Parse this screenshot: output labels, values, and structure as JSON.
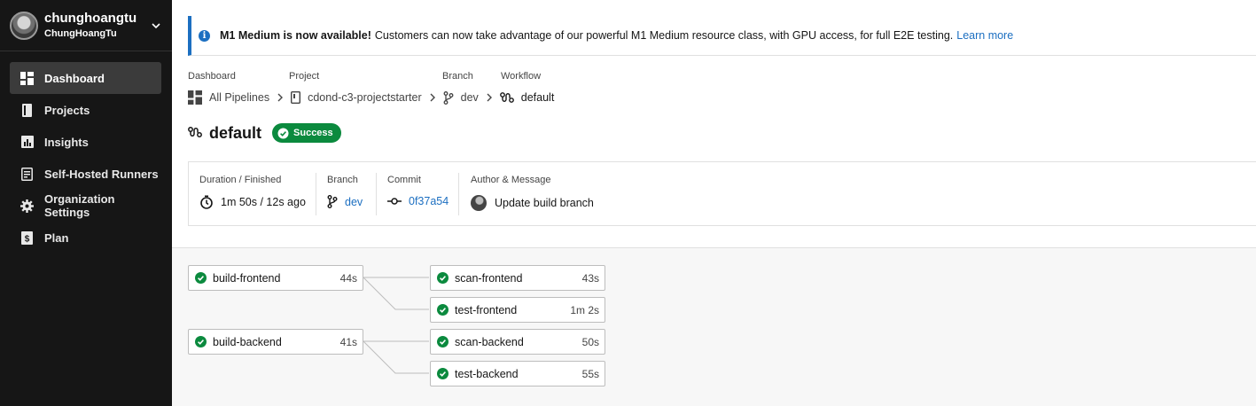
{
  "user": {
    "name": "chunghoangtu",
    "handle": "ChungHoangTu"
  },
  "nav": [
    {
      "label": "Dashboard",
      "icon": "dashboard-icon",
      "active": true
    },
    {
      "label": "Projects",
      "icon": "book-icon"
    },
    {
      "label": "Insights",
      "icon": "bar-chart-icon"
    },
    {
      "label": "Self-Hosted Runners",
      "icon": "runner-icon"
    },
    {
      "label": "Organization Settings",
      "icon": "gear-icon"
    },
    {
      "label": "Plan",
      "icon": "dollar-icon"
    }
  ],
  "banner": {
    "title": "M1 Medium is now available!",
    "text": "Customers can now take advantage of our powerful M1 Medium resource class, with GPU access, for full E2E testing.",
    "link": "Learn more",
    "accent": "#1c6fc1"
  },
  "breadcrumb": {
    "labels": {
      "dashboard": "Dashboard",
      "project": "Project",
      "branch": "Branch",
      "workflow": "Workflow"
    },
    "values": {
      "dashboard": "All Pipelines",
      "project": "cdond-c3-projectstarter",
      "branch": "dev",
      "workflow": "default"
    }
  },
  "workflow": {
    "name": "default",
    "status": "Success",
    "status_color": "#0b8a3e"
  },
  "details": {
    "duration_label": "Duration / Finished",
    "duration": "1m 50s / 12s ago",
    "branch_label": "Branch",
    "branch": "dev",
    "commit_label": "Commit",
    "commit": "0f37a54",
    "author_label": "Author & Message",
    "message": "Update build branch"
  },
  "jobs": {
    "build_frontend": {
      "name": "build-frontend",
      "duration": "44s"
    },
    "build_backend": {
      "name": "build-backend",
      "duration": "41s"
    },
    "scan_frontend": {
      "name": "scan-frontend",
      "duration": "43s"
    },
    "test_frontend": {
      "name": "test-frontend",
      "duration": "1m 2s"
    },
    "scan_backend": {
      "name": "scan-backend",
      "duration": "50s"
    },
    "test_backend": {
      "name": "test-backend",
      "duration": "55s"
    }
  }
}
